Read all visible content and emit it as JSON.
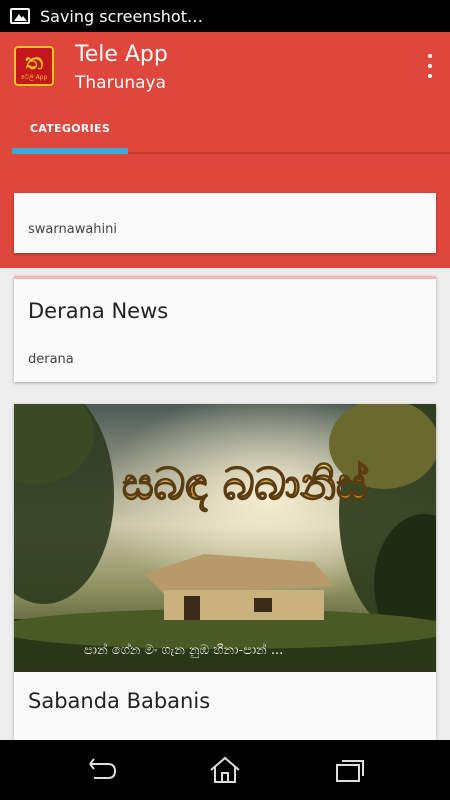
{
  "status_bar": {
    "notification_text": "Saving screenshot…",
    "icon": "image-icon"
  },
  "app_bar": {
    "title": "Tele App",
    "subtitle": "Tharunaya",
    "logo": {
      "glyph": "ත",
      "caption": "ටෙලි App"
    },
    "menu_icon": "overflow-menu-icon"
  },
  "tabs": [
    {
      "label": "CATEGORIES",
      "selected": true
    }
  ],
  "cards": [
    {
      "title": "",
      "subtitle": "swarnawahini"
    },
    {
      "title": "Derana News",
      "subtitle": "derana"
    },
    {
      "title": "Sabanda Babanis",
      "subtitle": "",
      "image": {
        "title_text": "සබඳ බබානිස්",
        "tagline": "පාන් ගේන මං ගැන නුඹ හිනා-පාන් ..."
      }
    }
  ],
  "nav_bar": {
    "back_icon": "back-icon",
    "home_icon": "home-icon",
    "recents_icon": "recents-icon"
  },
  "colors": {
    "primary": "#e0473c",
    "accent": "#41a7d8",
    "card": "#fafafa",
    "background": "#ededed"
  }
}
